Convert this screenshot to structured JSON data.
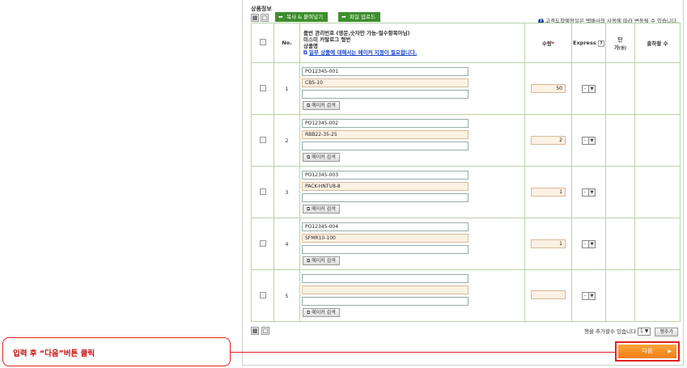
{
  "section_title": "상품정보",
  "toolbar": {
    "copy_paste_label": "복사 & 붙여넣기",
    "file_upload_label": "파일 업로드",
    "notice": "고객도착예정일은 택배사의 사정에 따라 변동될 수 있습니다."
  },
  "table": {
    "headers": {
      "no": "No.",
      "item_line1": "품번 관리번호 (영문,숫자만 가능-필수항목아님)",
      "item_line2": "미스미 카탈로그 형번",
      "item_line3": "상품명",
      "maker_notice": "일부 상품에 대해서는 메이커 지정이 필요합니다.",
      "qty": "수량",
      "express": "Express",
      "unit_price_1": "단",
      "unit_price_2": "가",
      "unit_price_unit": "(원)",
      "ship_days": "출하할 수"
    },
    "rows": [
      {
        "no": "1",
        "mgmt": "PO12345-001",
        "model": "CB5-10",
        "name": "",
        "qty": "50",
        "express": "-"
      },
      {
        "no": "2",
        "mgmt": "PO12345-002",
        "model": "RBB22-35-25",
        "name": "",
        "qty": "2",
        "express": "-"
      },
      {
        "no": "3",
        "mgmt": "PO12345-003",
        "model": "PACK-HNTU8-8",
        "name": "",
        "qty": "1",
        "express": "-"
      },
      {
        "no": "4",
        "mgmt": "PO12345-004",
        "model": "SFMR10-100",
        "name": "",
        "qty": "1",
        "express": "-"
      },
      {
        "no": "5",
        "mgmt": "",
        "model": "",
        "name": "",
        "qty": "",
        "express": "-"
      }
    ],
    "maker_search_label": "메이커 검색"
  },
  "footer": {
    "rows_addable_text": "행을 추가할수 있습니다",
    "rows_count": "1",
    "add_row_label": "행추가",
    "next_label": "다음"
  },
  "callout": {
    "text": "입력 후 “다음”버튼 클릭"
  },
  "colors": {
    "accent_green": "#3d8f2c",
    "next_orange": "#f07d14",
    "callout_red": "#e02020",
    "link_blue": "#1a45c8"
  }
}
